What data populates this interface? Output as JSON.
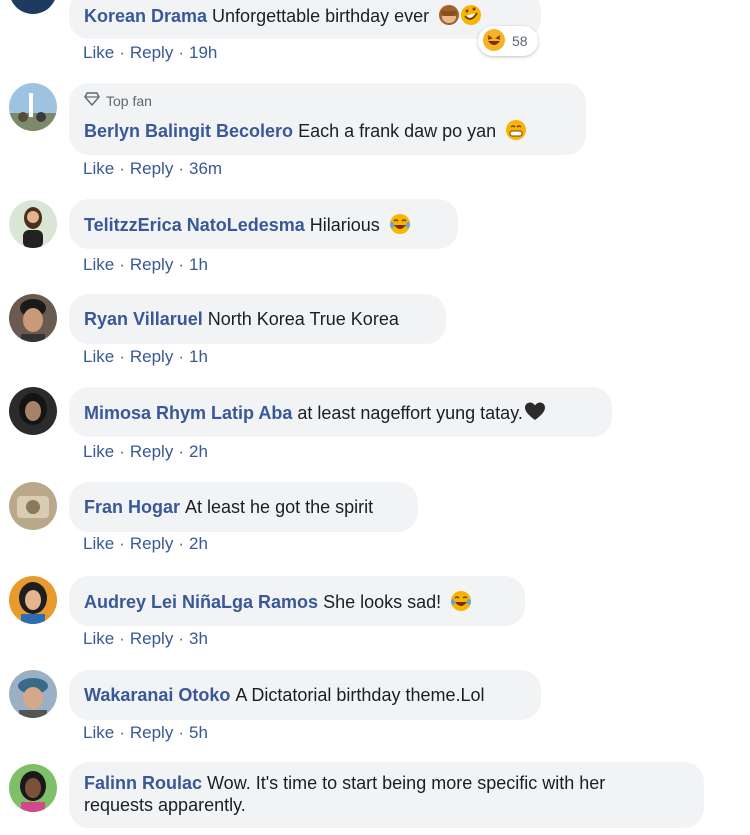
{
  "comments": [
    {
      "author": "Korean Drama",
      "text": "Unforgettable birthday ever",
      "emoji": [
        "see-no-evil-monkey",
        "rolling-laughing"
      ],
      "actions": {
        "like": "Like",
        "reply": "Reply",
        "time": "19h"
      },
      "reactions": {
        "icon": "haha-reaction",
        "count": "58"
      }
    },
    {
      "badge": "Top fan",
      "author": "Berlyn Balingit Becolero",
      "text": "Each a frank daw po yan",
      "emoji": [
        "grinning-face"
      ],
      "actions": {
        "like": "Like",
        "reply": "Reply",
        "time": "36m"
      }
    },
    {
      "author": "TelitzzErica NatoLedesma",
      "text": "Hilarious",
      "emoji": [
        "tears-of-joy"
      ],
      "actions": {
        "like": "Like",
        "reply": "Reply",
        "time": "1h"
      }
    },
    {
      "author": "Ryan Villaruel",
      "text": "North Korea True Korea",
      "actions": {
        "like": "Like",
        "reply": "Reply",
        "time": "1h"
      }
    },
    {
      "author": "Mimosa Rhym Latip Aba",
      "text": "at least nageffort yung tatay.",
      "emoji": [
        "black-heart"
      ],
      "actions": {
        "like": "Like",
        "reply": "Reply",
        "time": "2h"
      }
    },
    {
      "author": "Fran Hogar",
      "text": "At least he got the spirit",
      "actions": {
        "like": "Like",
        "reply": "Reply",
        "time": "2h"
      }
    },
    {
      "author": "Audrey Lei NiñaLga Ramos",
      "text": "She looks sad!",
      "emoji": [
        "tears-of-joy"
      ],
      "actions": {
        "like": "Like",
        "reply": "Reply",
        "time": "3h"
      }
    },
    {
      "author": "Wakaranai Otoko",
      "text": "A Dictatorial birthday theme.Lol",
      "actions": {
        "like": "Like",
        "reply": "Reply",
        "time": "5h"
      }
    },
    {
      "author": "Falinn Roulac",
      "text_line1": "Wow. It's time to start being more specific with her",
      "text_line2": "requests apparently."
    }
  ],
  "colors": {
    "author": "#385898",
    "bubble": "#f2f3f5",
    "text": "#1c1e21",
    "meta": "#606770"
  },
  "separator": "·"
}
